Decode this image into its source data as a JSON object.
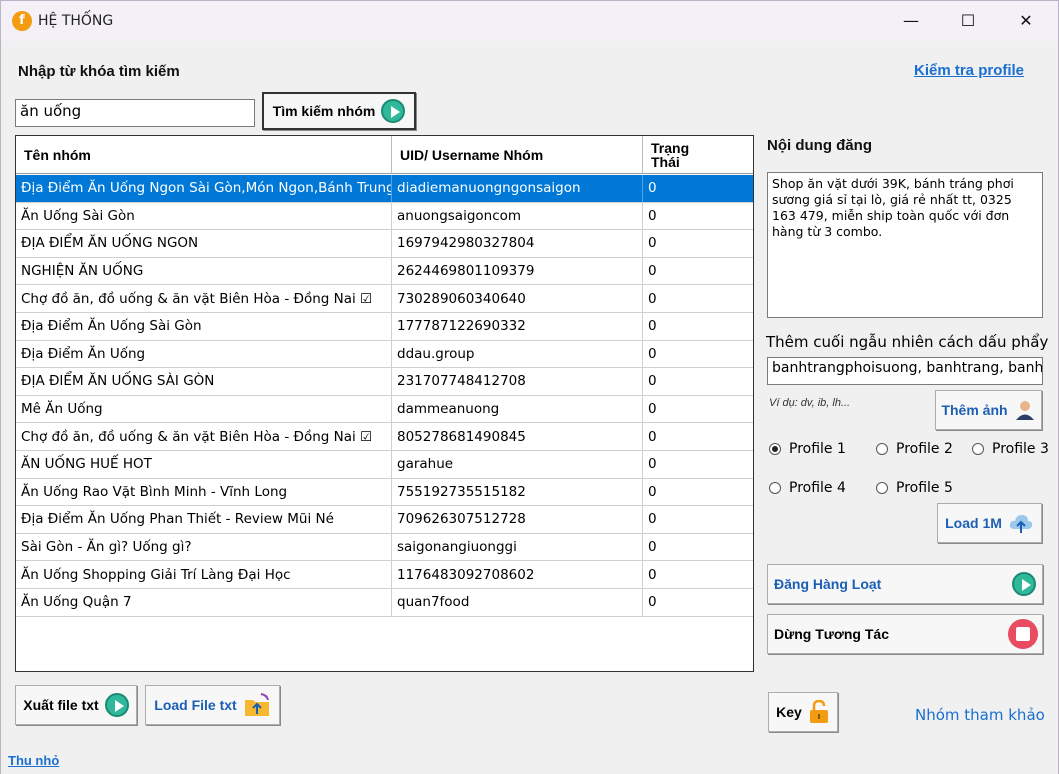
{
  "window": {
    "title": "HỆ THỐNG",
    "minimize": "—",
    "maximize": "☐",
    "close": "✕"
  },
  "search": {
    "label": "Nhập từ khóa tìm kiếm",
    "value": "ăn uống",
    "button": "Tìm kiếm nhóm"
  },
  "check_profile_link": "Kiểm tra profile",
  "table": {
    "headers": {
      "name": "Tên nhóm",
      "uid": "UID/ Username Nhóm",
      "status_line1": "Trạng",
      "status_line2": "Thái"
    },
    "rows": [
      {
        "name": "Địa Điểm Ăn Uống Ngon Sài Gòn,Món Ngon,Bánh Trung Th...",
        "uid": "diadiemanuongngonsaigon",
        "status": "0"
      },
      {
        "name": "Ăn Uống Sài Gòn",
        "uid": "anuongsaigoncom",
        "status": "0"
      },
      {
        "name": "ĐỊA ĐIỂM ĂN UỐNG NGON",
        "uid": "1697942980327804",
        "status": "0"
      },
      {
        "name": "NGHIỆN ĂN UỐNG",
        "uid": "2624469801109379",
        "status": "0"
      },
      {
        "name": "Chợ đồ ăn, đồ uống & ăn vặt Biên Hòa - Đồng Nai ☑",
        "uid": "730289060340640",
        "status": "0"
      },
      {
        "name": "Địa Điểm Ăn Uống Sài Gòn",
        "uid": "177787122690332",
        "status": "0"
      },
      {
        "name": "Địa Điểm Ăn Uống",
        "uid": "ddau.group",
        "status": "0"
      },
      {
        "name": "ĐỊA ĐIỂM ĂN UỐNG SÀI GÒN",
        "uid": "231707748412708",
        "status": "0"
      },
      {
        "name": "Mê Ăn Uống",
        "uid": "dammeanuong",
        "status": "0"
      },
      {
        "name": "Chợ đồ ăn, đồ uống & ăn vặt Biên Hòa - Đồng Nai ☑",
        "uid": "805278681490845",
        "status": "0"
      },
      {
        "name": "ĂN UỐNG HUẾ HOT",
        "uid": "garahue",
        "status": "0"
      },
      {
        "name": "Ăn Uống Rao Vặt Bình Minh - Vĩnh Long",
        "uid": "755192735515182",
        "status": "0"
      },
      {
        "name": "Địa Điểm Ăn Uống Phan Thiết - Review Mũi Né",
        "uid": "709626307512728",
        "status": "0"
      },
      {
        "name": "Sài Gòn - Ăn gì? Uống gì?",
        "uid": "saigonangiuonggi",
        "status": "0"
      },
      {
        "name": "Ăn Uống Shopping Giải Trí Làng Đại Học",
        "uid": "1176483092708602",
        "status": "0"
      },
      {
        "name": "Ăn Uống Quận 7",
        "uid": "quan7food",
        "status": "0"
      }
    ]
  },
  "content": {
    "label": "Nội dung đăng",
    "text": "Shop ăn vặt dưới 39K, bánh tráng phơi sương giá sỉ tại lò, giá rẻ nhất tt, 0325 163 479, miễn ship toàn quốc với đơn hàng từ 3 combo.",
    "suffix_label": "Thêm cuối ngẫu nhiên cách dấu phẩy",
    "suffix_value": "banhtrangphoisuong, banhtrang, banhp",
    "example": "Ví dụ: dv, ib, lh...",
    "add_image": "Thêm ảnh"
  },
  "profiles": [
    {
      "label": "Profile 1",
      "checked": true
    },
    {
      "label": "Profile 2",
      "checked": false
    },
    {
      "label": "Profile 3",
      "checked": false
    },
    {
      "label": "Profile 4",
      "checked": false
    },
    {
      "label": "Profile 5",
      "checked": false
    }
  ],
  "buttons": {
    "load1m": "Load 1M",
    "post_all": "Đăng Hàng Loạt",
    "stop": "Dừng Tương Tác",
    "export": "Xuất file txt",
    "load_file": "Load File txt",
    "key": "Key"
  },
  "reference_groups": "Nhóm tham khảo",
  "minimize_link": "Thu nhỏ",
  "colors": {
    "selection": "#0078d7",
    "link": "#1a6fd0",
    "play": "#2fb89a",
    "stop": "#e94b60",
    "app_icon": "#f39c12"
  }
}
